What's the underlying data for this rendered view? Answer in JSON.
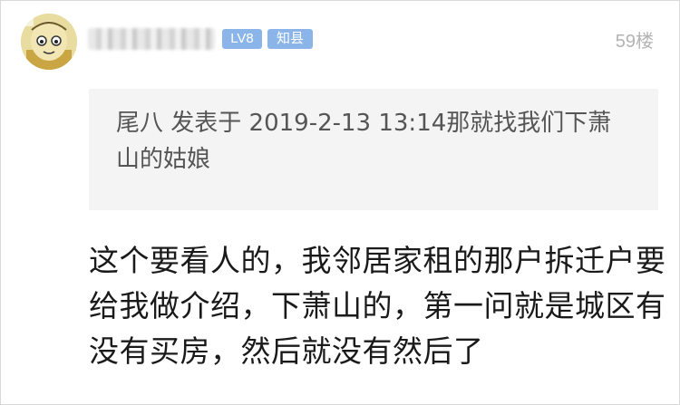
{
  "post": {
    "level_badge": "LV8",
    "title_badge": "知县",
    "floor": "59楼",
    "quote": "尾八 发表于 2019-2-13 13:14那就找我们下萧山的姑娘",
    "content": "这个要看人的，我邻居家租的那户拆迁户要给我做介绍，下萧山的，第一问就是城区有没有买房，然后就没有然后了"
  },
  "colors": {
    "badge": "#8bb5e8",
    "quote_bg": "#f4f4f4",
    "floor_text": "#b3b3b3"
  },
  "icons": {
    "avatar": "cartoon-face-avatar"
  }
}
